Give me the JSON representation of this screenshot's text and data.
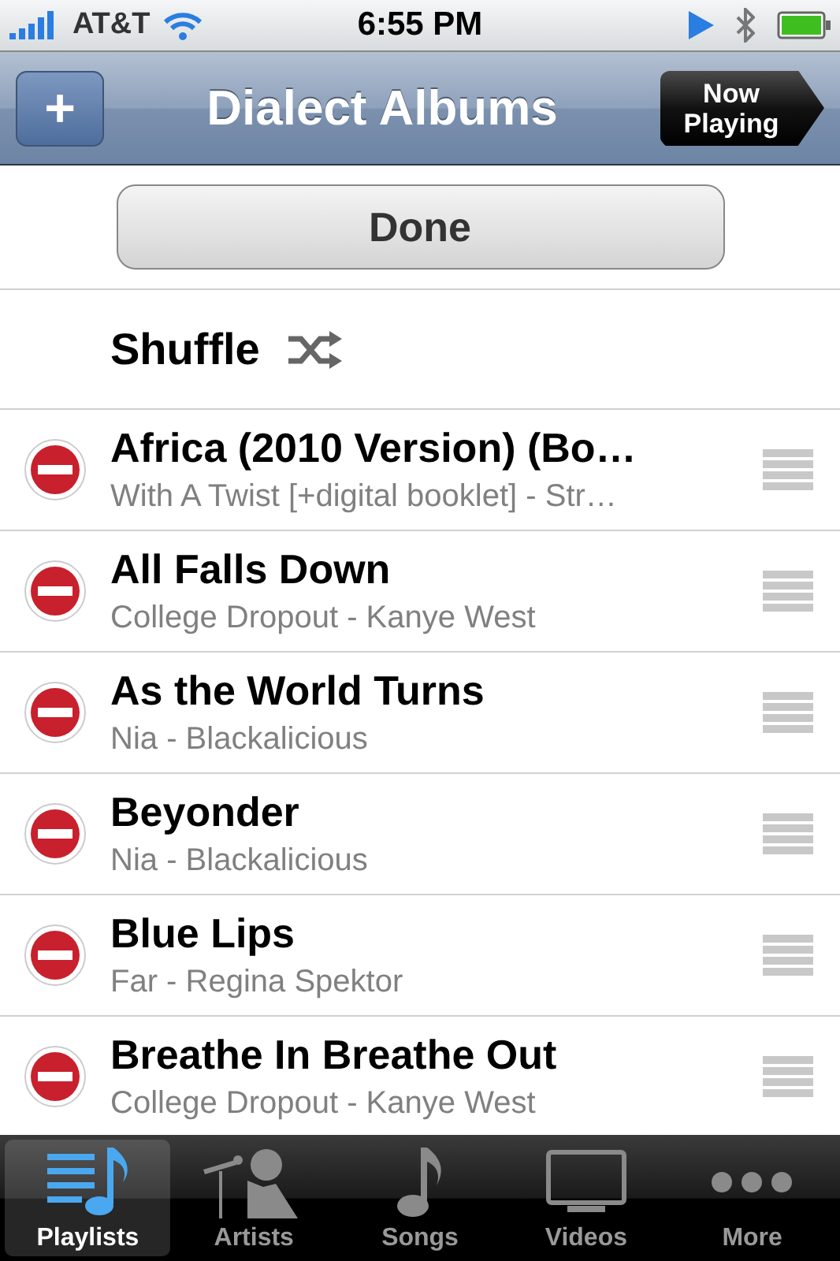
{
  "status_bar": {
    "carrier": "AT&T",
    "time": "6:55 PM"
  },
  "nav_bar": {
    "title": "Dialect Albums",
    "add_button": "+",
    "now_playing_button": "Now Playing"
  },
  "done_button": "Done",
  "shuffle": {
    "label": "Shuffle"
  },
  "songs": [
    {
      "title": "Africa (2010 Version) (Bo…",
      "subtitle": "With A Twist [+digital booklet] - Str…"
    },
    {
      "title": "All Falls Down",
      "subtitle": "College Dropout - Kanye West"
    },
    {
      "title": "As the World Turns",
      "subtitle": "Nia - Blackalicious"
    },
    {
      "title": "Beyonder",
      "subtitle": "Nia - Blackalicious"
    },
    {
      "title": "Blue Lips",
      "subtitle": "Far - Regina Spektor"
    },
    {
      "title": "Breathe In Breathe Out",
      "subtitle": "College Dropout - Kanye West"
    }
  ],
  "tab_bar": [
    {
      "kind": "playlists",
      "label": "Playlists",
      "selected": true
    },
    {
      "kind": "artists",
      "label": "Artists",
      "selected": false
    },
    {
      "kind": "songs",
      "label": "Songs",
      "selected": false
    },
    {
      "kind": "videos",
      "label": "Videos",
      "selected": false
    },
    {
      "kind": "more",
      "label": "More",
      "selected": false
    }
  ]
}
